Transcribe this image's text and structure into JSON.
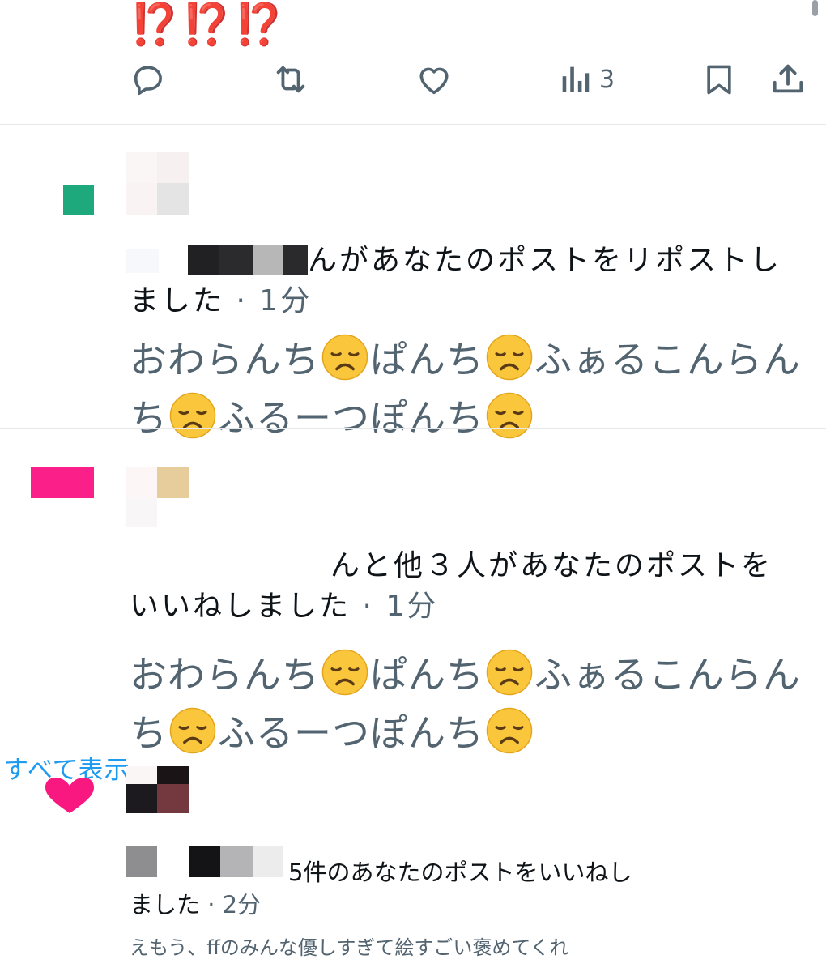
{
  "tweet": {
    "marks": "⁉️⁉️⁉️",
    "actions": {
      "reply_icon": "reply-icon",
      "retweet_icon": "retweet-icon",
      "like_icon": "heart-icon",
      "views_icon": "bar-chart-icon",
      "views_count": "3",
      "bookmark_icon": "bookmark-icon",
      "share_icon": "share-icon"
    }
  },
  "notifications": [
    {
      "type": "repost",
      "icon_color": "#1ea97c",
      "text": "んがあなたのポストをリポストしました",
      "time": " · 1分",
      "quoted_parts": [
        "おわらんち",
        "ぱんち",
        "ふぁるこんらんち",
        "ふるーつぽんち",
        ""
      ]
    },
    {
      "type": "like",
      "icon_color": "#f91880",
      "text": "んと他３人があなたのポストをいいねしました",
      "time": " · 1分",
      "quoted_parts": [
        "おわらんち",
        "ぱんち",
        "ふぁるこんらんち",
        "ふるーつぽんち",
        ""
      ]
    },
    {
      "type": "like",
      "icon_color": "#f91880",
      "text": "5件のあなたのポストをいいねしました",
      "time": " · 2分",
      "quoted_preview": "えもう、ffのみんな優しすぎて絵すごい褒めてくれ"
    }
  ],
  "show_all_label": "すべて表示",
  "colors": {
    "accent": "#1d9bf0",
    "muted": "#536471",
    "repost_green": "#1ea97c",
    "like_pink": "#f91880",
    "alert_red": "#e0241b"
  }
}
